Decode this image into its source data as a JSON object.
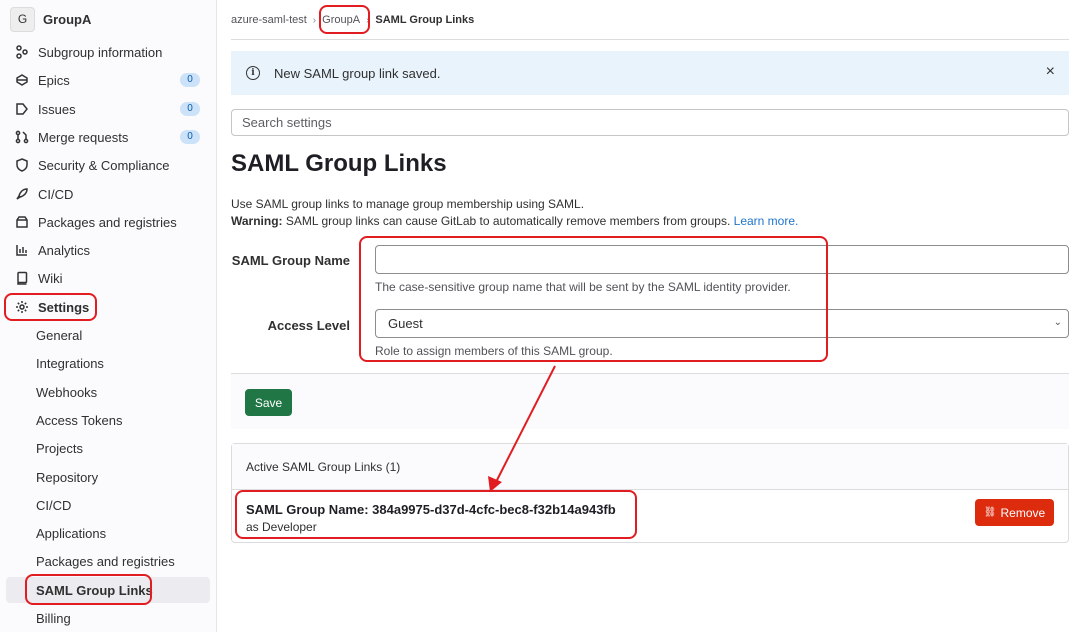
{
  "sidebar": {
    "group_initial": "G",
    "group_name": "GroupA",
    "items": [
      {
        "label": "Subgroup information",
        "icon": "subgroup-icon"
      },
      {
        "label": "Epics",
        "icon": "epic-icon",
        "count": "0"
      },
      {
        "label": "Issues",
        "icon": "issues-icon",
        "count": "0"
      },
      {
        "label": "Merge requests",
        "icon": "merge-request-icon",
        "count": "0"
      },
      {
        "label": "Security & Compliance",
        "icon": "shield-icon"
      },
      {
        "label": "CI/CD",
        "icon": "rocket-icon"
      },
      {
        "label": "Packages and registries",
        "icon": "package-icon"
      },
      {
        "label": "Analytics",
        "icon": "analytics-icon"
      },
      {
        "label": "Wiki",
        "icon": "book-icon"
      },
      {
        "label": "Settings",
        "icon": "gear-icon"
      }
    ],
    "settings_items": [
      "General",
      "Integrations",
      "Webhooks",
      "Access Tokens",
      "Projects",
      "Repository",
      "CI/CD",
      "Applications",
      "Packages and registries",
      "SAML Group Links",
      "Billing"
    ]
  },
  "breadcrumb": {
    "root": "azure-saml-test",
    "group": "GroupA",
    "current": "SAML Group Links"
  },
  "alert": {
    "message": "New SAML group link saved.",
    "close": "×"
  },
  "search": {
    "placeholder": "Search settings"
  },
  "page": {
    "title": "SAML Group Links",
    "desc": "Use SAML group links to manage group membership using SAML.",
    "warning_label": "Warning:",
    "warning_text": " SAML group links can cause GitLab to automatically remove members from groups. ",
    "learn_more": "Learn more."
  },
  "form": {
    "group_name_label": "SAML Group Name",
    "group_name_value": "",
    "group_name_help": "The case-sensitive group name that will be sent by the SAML identity provider.",
    "access_level_label": "Access Level",
    "access_level_value": "Guest",
    "access_level_help": "Role to assign members of this SAML group.",
    "save_label": "Save"
  },
  "links": {
    "header": "Active SAML Group Links (1)",
    "items": [
      {
        "name": "SAML Group Name: 384a9975-d37d-4cfc-bec8-f32b14a943fb",
        "role": "as Developer",
        "remove_label": "Remove"
      }
    ]
  },
  "colors": {
    "accent_red": "#e11d21",
    "save_green": "#217645",
    "remove_red": "#dd2b0e",
    "info_bg": "#e9f3fc"
  }
}
